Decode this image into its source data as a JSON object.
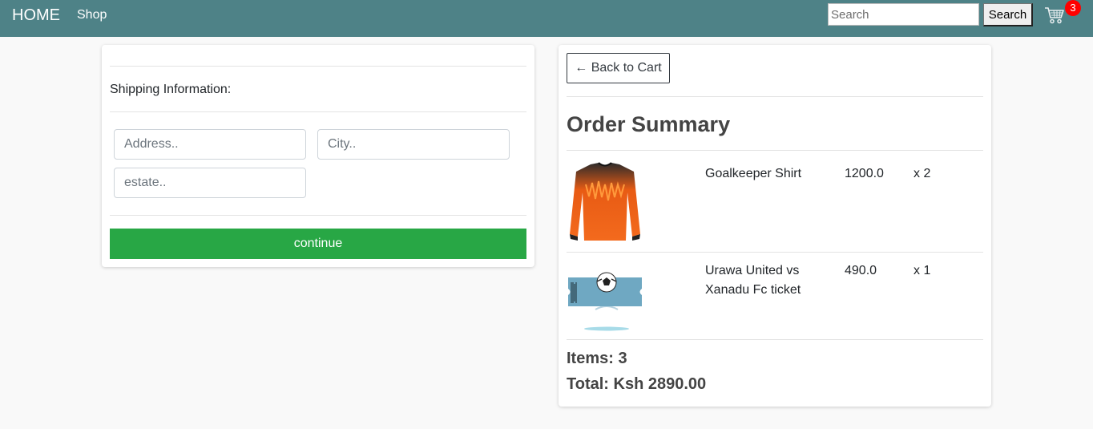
{
  "navbar": {
    "brand": "HOME",
    "shop_link": "Shop",
    "search_placeholder": "Search",
    "search_button": "Search",
    "cart_count": "3"
  },
  "shipping": {
    "heading": "Shipping Information:",
    "address_placeholder": "Address..",
    "city_placeholder": "City..",
    "estate_placeholder": "estate..",
    "continue_label": "continue"
  },
  "summary": {
    "back_label": "← Back to Cart",
    "title": "Order Summary",
    "items": [
      {
        "name": "Goalkeeper Shirt",
        "price": "1200.0",
        "qty": "x 2",
        "image": "orange-goalkeeper-shirt"
      },
      {
        "name": "Urawa United vs Xanadu Fc ticket",
        "price": "490.0",
        "qty": "x 1",
        "image": "match-ticket"
      }
    ],
    "items_total": "Items: 3",
    "grand_total": "Total: Ksh 2890.00"
  },
  "colors": {
    "navbar": "#4e8287",
    "continue_button": "#28a745",
    "badge": "#ff0000"
  }
}
